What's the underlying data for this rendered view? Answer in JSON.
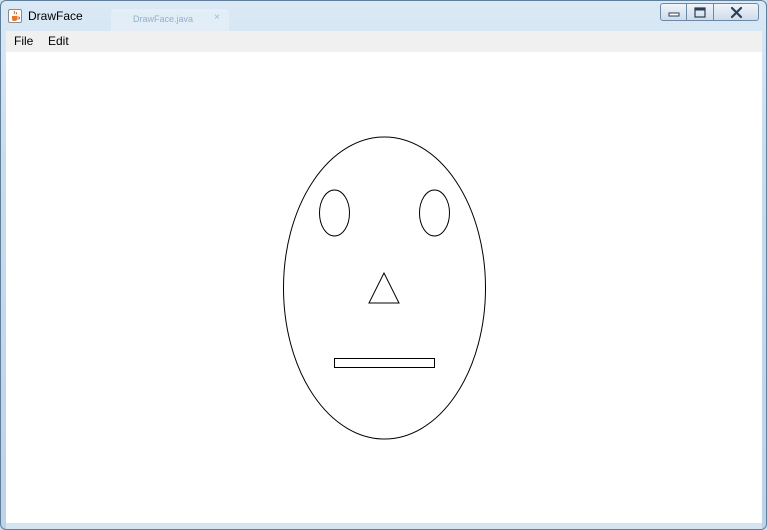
{
  "window": {
    "title": "DrawFace",
    "background_tab_title": "DrawFace.java",
    "background_tab_close": "×",
    "controls": [
      "minimize",
      "maximize",
      "close"
    ]
  },
  "menu": {
    "items": [
      {
        "label": "File"
      },
      {
        "label": "Edit"
      }
    ]
  },
  "colors": {
    "canvas_background": "#ffffff",
    "stroke": "#000000",
    "menubar": "#f0f0f0",
    "window_frame": "#bcd3e8"
  },
  "icons": {
    "app": "java-cup-icon",
    "minimize": "minimize-icon",
    "maximize": "maximize-icon",
    "close": "close-icon"
  }
}
